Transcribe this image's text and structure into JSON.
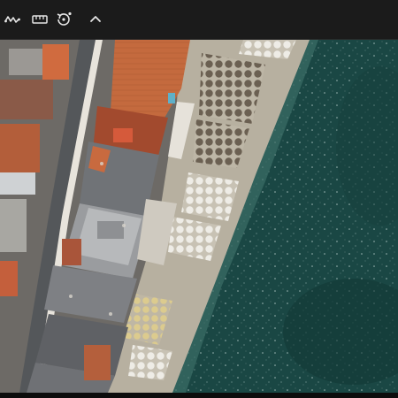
{
  "toolbar": {
    "items": [
      {
        "name": "waveform-icon"
      },
      {
        "name": "ruler-icon"
      },
      {
        "name": "rotate-icon"
      },
      {
        "name": "chevron-up-icon"
      }
    ],
    "icon_color": "#e6e6e6"
  },
  "viewport": {
    "content": "aerial-photo-beach-town",
    "colors": {
      "sea": "#1d4d4a",
      "sand": "#b9b2a3",
      "roof_terracotta": "#c86a3f",
      "roof_grey": "#7d7f82",
      "street": "#5b5d60",
      "umbrella_white": "#e9e7e1",
      "umbrella_yellow": "#d9c88a"
    }
  }
}
